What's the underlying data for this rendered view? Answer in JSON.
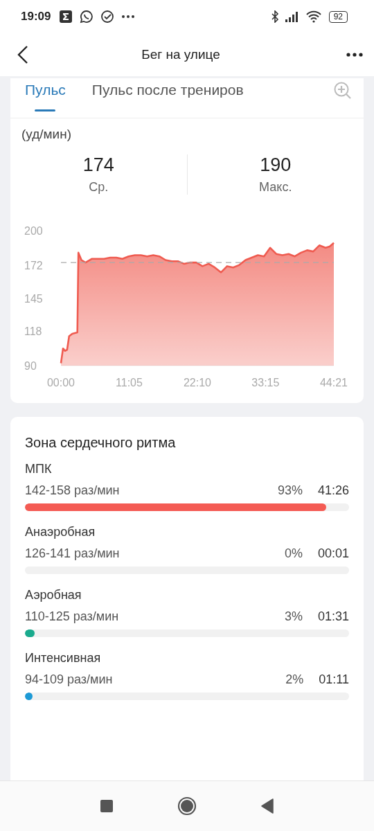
{
  "status_bar": {
    "time": "19:09",
    "battery": "92"
  },
  "header": {
    "title": "Бег на улице"
  },
  "tabs": [
    {
      "label": "Пульс",
      "selected": true
    },
    {
      "label": "Пульс после трениров",
      "selected": false
    }
  ],
  "unit": "(уд/мин)",
  "stats": [
    {
      "value": "174",
      "label": "Ср."
    },
    {
      "value": "190",
      "label": "Макс."
    }
  ],
  "chart": {
    "chart_data": {
      "type": "area",
      "x": [
        0,
        20,
        40,
        60,
        80,
        110,
        160,
        170,
        200,
        240,
        300,
        360,
        420,
        480,
        540,
        600,
        660,
        720,
        780,
        840,
        900,
        960,
        1020,
        1080,
        1140,
        1200,
        1260,
        1320,
        1380,
        1440,
        1500,
        1560,
        1620,
        1680,
        1740,
        1800,
        1860,
        1920,
        1980,
        2040,
        2100,
        2160,
        2220,
        2280,
        2340,
        2400,
        2460,
        2520,
        2580,
        2620,
        2661
      ],
      "series": [
        {
          "color": "#ef5b50",
          "values": [
            92,
            104,
            102,
            103,
            114,
            116,
            117,
            182,
            176,
            174,
            177,
            177,
            177,
            178,
            178,
            177,
            179,
            180,
            180,
            179,
            180,
            179,
            176,
            175,
            175,
            173,
            174,
            174,
            171,
            173,
            170,
            166,
            171,
            170,
            172,
            176,
            178,
            180,
            179,
            186,
            181,
            180,
            181,
            179,
            182,
            184,
            183,
            188,
            186,
            187,
            190
          ]
        }
      ],
      "xlim": [
        0,
        2661
      ],
      "ylim": [
        90,
        200
      ],
      "xticks": [
        {
          "value": 0,
          "label": "00:00"
        },
        {
          "value": 665,
          "label": "11:05"
        },
        {
          "value": 1330,
          "label": "22:10"
        },
        {
          "value": 1995,
          "label": "33:15"
        },
        {
          "value": 2661,
          "label": "44:21"
        }
      ],
      "yticks": [
        90,
        118,
        145,
        172,
        200
      ],
      "ref_lines": [
        {
          "axis": "y",
          "value": 174
        }
      ]
    }
  },
  "zones": {
    "title": "Зона сердечного ритма",
    "items": [
      {
        "name": "МПК",
        "range": "142-158 раз/мин",
        "percent": "93%",
        "time": "41:26",
        "level": 0.93,
        "color": "#f45b54"
      },
      {
        "name": "Анаэробная",
        "range": "126-141 раз/мин",
        "percent": "0%",
        "time": "00:01"
      },
      {
        "name": "Аэробная",
        "range": "110-125 раз/мин",
        "percent": "3%",
        "time": "01:31",
        "level": 0.03,
        "color": "#1aab8e"
      },
      {
        "name": "Интенсивная",
        "range": "94-109 раз/мин",
        "percent": "2%",
        "time": "01:11",
        "level": 0.02,
        "color": "#1d9ad6"
      }
    ]
  }
}
